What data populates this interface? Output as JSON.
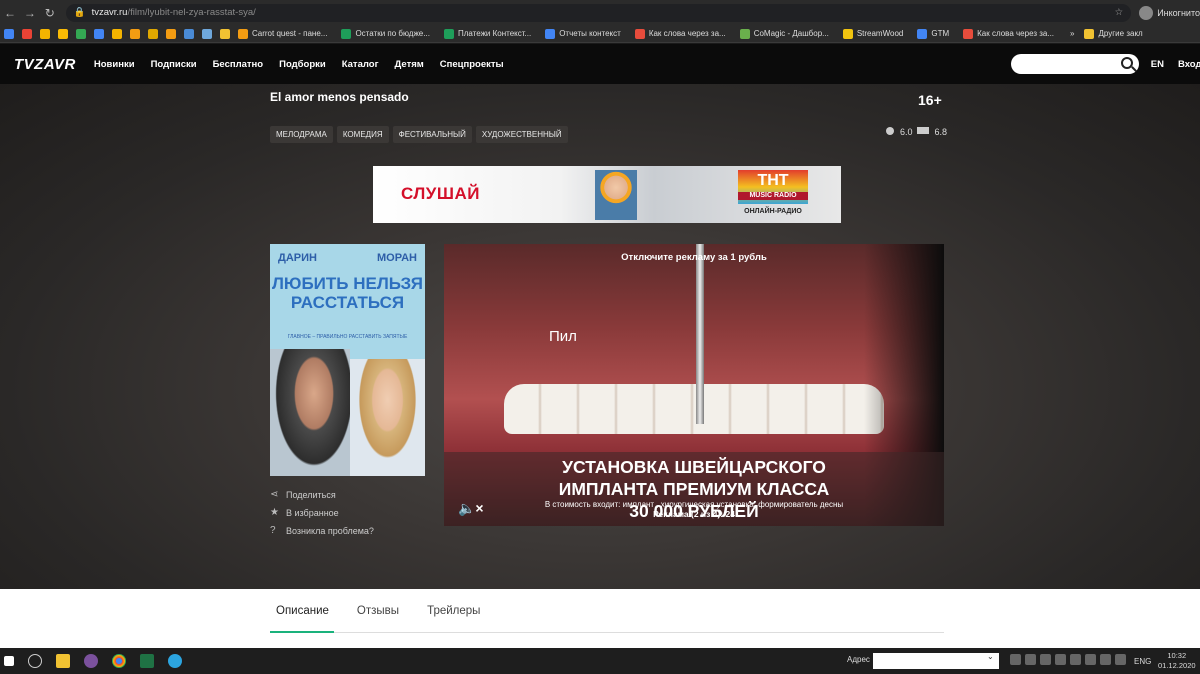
{
  "browser": {
    "url_host": "tvzavr.ru",
    "url_path": "/film/lyubit-nel-zya-rasstat-sya/",
    "incognito_label": "Инкогнито",
    "bookmarks": [
      {
        "label": "Carrot quest - пане...",
        "color": "#f39c12"
      },
      {
        "label": "Остатки по бюдже...",
        "color": "#1e9e5a"
      },
      {
        "label": "Платежи Контекст...",
        "color": "#1e9e5a"
      },
      {
        "label": "Отчеты контекст",
        "color": "#4285f4"
      },
      {
        "label": "Как слова через за...",
        "color": "#e74c3c"
      },
      {
        "label": "CoMagic - Дашбор...",
        "color": "#6ab04c"
      },
      {
        "label": "StreamWood",
        "color": "#f1c40f"
      },
      {
        "label": "GTM",
        "color": "#4285f4"
      },
      {
        "label": "Как слова через за...",
        "color": "#e74c3c"
      }
    ],
    "other_bookmarks": "Другие закл"
  },
  "header": {
    "logo": "TVZAVR",
    "menu": [
      "Новинки",
      "Подписки",
      "Бесплатно",
      "Подборки",
      "Каталог",
      "Детям",
      "Спецпроекты"
    ],
    "lang": "EN",
    "login": "Вход"
  },
  "film": {
    "title": "El amor menos pensado",
    "age": "16+",
    "genres": [
      "МЕЛОДРАМА",
      "КОМЕДИЯ",
      "ФЕСТИВАЛЬНЫЙ",
      "ХУДОЖЕСТВЕННЫЙ"
    ],
    "rating_kp": "6.0",
    "rating_imdb": "6.8"
  },
  "banner": {
    "left_text": "СЛУШАЙ",
    "logo_text": "ТНТ",
    "logo_sub": "MUSIC RADIO",
    "sub_text": "ОНЛАЙН-РАДИО"
  },
  "poster": {
    "name_left": "ДАРИН",
    "name_right": "МОРАН",
    "title": "ЛЮБИТЬ НЕЛЬЗЯ РАССТАТЬСЯ",
    "tagline": "ГЛАВНОЕ – ПРАВИЛЬНО РАССТАВИТЬ ЗАПЯТЫЕ"
  },
  "actions": {
    "share": "Поделиться",
    "favorite": "В избранное",
    "problem": "Возникла проблема?"
  },
  "ad": {
    "top_text": "Отключите рекламу за 1 рубль",
    "overlay_word": "Пил",
    "headline": "УСТАНОВКА ШВЕЙЦАРСКОГО ИМПЛАНТА ПРЕМИУМ КЛАССА 30 000 РУБЛЕЙ",
    "small_text": "В стоимость входит: имплант , хирургическая установка, формирователь десны",
    "counter": "Реклама (2 из 4): 24"
  },
  "tabs": [
    "Описание",
    "Отзывы",
    "Трейлеры"
  ],
  "taskbar": {
    "address_label": "Адрес",
    "lang": "ENG",
    "time": "10:32",
    "date": "01.12.2020"
  }
}
